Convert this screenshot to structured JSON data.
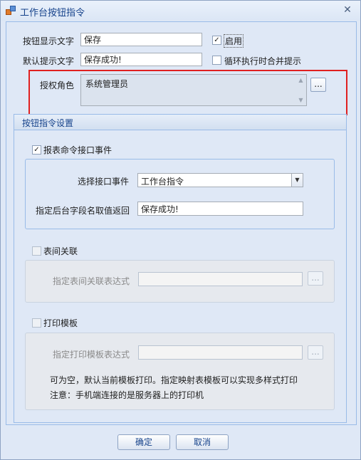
{
  "window": {
    "title": "工作台按钮指令"
  },
  "form": {
    "display_text_label": "按钮显示文字",
    "display_text_value": "保存",
    "enabled_label": "启用",
    "enabled_checked": true,
    "prompt_text_label": "默认提示文字",
    "prompt_text_value": "保存成功!",
    "merge_prompt_label": "循环执行时合并提示",
    "merge_prompt_checked": false,
    "role_label": "授权角色",
    "role_value": "系统管理员",
    "role_button": "..."
  },
  "group": {
    "title": "按钮指令设置",
    "report_event": {
      "label": "报表命令接口事件",
      "checked": true,
      "select_event_label": "选择接口事件",
      "select_event_value": "工作台指令",
      "return_field_label": "指定后台字段名取值返回",
      "return_field_value": "保存成功!"
    },
    "table_relation": {
      "label": "表间关联",
      "checked": false,
      "expr_label": "指定表间关联表达式",
      "expr_value": "",
      "button": "..."
    },
    "print_template": {
      "label": "打印模板",
      "checked": false,
      "expr_label": "指定打印模板表达式",
      "expr_value": "",
      "button": "...",
      "note1": "可为空，默认当前模板打印。指定映射表模板可以实现多样式打印",
      "note2": "注意：手机端连接的是服务器上的打印机"
    }
  },
  "footer": {
    "ok_label": "确定",
    "cancel_label": "取消"
  },
  "icons": {
    "app": "app-icon",
    "close": "close-icon",
    "check": "✓",
    "scroll_up": "▲",
    "scroll_down": "▼",
    "dropdown": "▼"
  },
  "colors": {
    "highlight": "#e02020",
    "title_text": "#15428b",
    "background": "#dfe8f6"
  }
}
